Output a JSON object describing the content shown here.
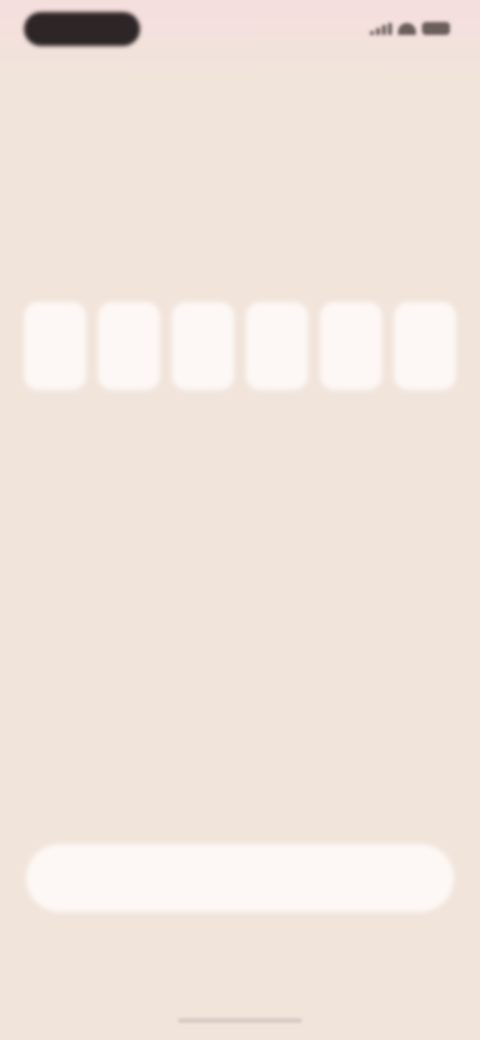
{
  "status_bar": {
    "icons": [
      "signal-icon",
      "wifi-icon",
      "battery-icon"
    ]
  },
  "header": {
    "title": "",
    "subtitle": ""
  },
  "code_input": {
    "digits": [
      "",
      "",
      "",
      "",
      "",
      ""
    ]
  },
  "actions": {
    "primary_label": ""
  },
  "colors": {
    "background": "#f1e4db",
    "box": "#fdf8f5",
    "status_pill": "#2e2626"
  }
}
